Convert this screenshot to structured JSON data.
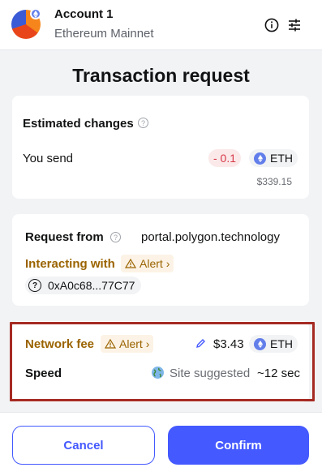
{
  "header": {
    "account_name": "Account 1",
    "network_name": "Ethereum Mainnet",
    "info_icon": "info-icon",
    "settings_icon": "sliders-icon"
  },
  "page_title": "Transaction request",
  "estimated_changes": {
    "label": "Estimated changes",
    "send_label": "You send",
    "amount": "- 0.1",
    "token": "ETH",
    "fiat": "$339.15"
  },
  "request": {
    "from_label": "Request from",
    "from_value": "portal.polygon.technology",
    "interacting_label": "Interacting with",
    "alert_label": "Alert",
    "address": "0xA0c68...77C77"
  },
  "fee": {
    "label": "Network fee",
    "alert_label": "Alert",
    "amount": "$3.43",
    "token": "ETH",
    "speed_label": "Speed",
    "speed_value": "Site suggested",
    "speed_time": "~12 sec"
  },
  "footer": {
    "cancel_label": "Cancel",
    "confirm_label": "Confirm"
  },
  "colors": {
    "primary": "#4459ff",
    "alert": "#9a6300",
    "error_bg": "#fbe9ea",
    "error_text": "#d73847",
    "highlight_border": "#a52a22",
    "eth": "#627eea"
  }
}
